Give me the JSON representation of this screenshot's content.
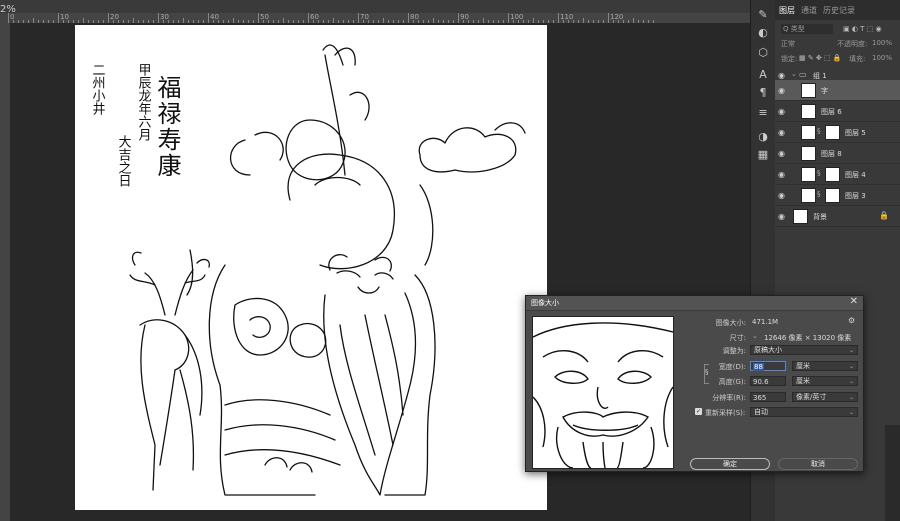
{
  "document": {
    "zoom_tab": "2%"
  },
  "rulers": {
    "top_numbers": [
      "0",
      "10",
      "20",
      "30",
      "40",
      "50",
      "60",
      "70",
      "80",
      "90",
      "100",
      "110",
      "120"
    ]
  },
  "artwork": {
    "title_chars": "福禄寿康",
    "inscription_line1": "甲辰龙年六月",
    "inscription_line2": "大吉之日",
    "signature": "二州小井"
  },
  "layers_panel": {
    "tabs": [
      "图层",
      "通道",
      "历史记录"
    ],
    "filter_label": "Q 类型",
    "blend_mode": "正常",
    "opacity_label": "不透明度:",
    "opacity_value": "100%",
    "lock_label": "锁定:",
    "fill_label": "填充:",
    "fill_value": "100%",
    "layers": [
      {
        "name": "组 1",
        "type": "group"
      },
      {
        "name": "字",
        "type": "layer",
        "selected": true
      },
      {
        "name": "图层 6",
        "type": "layer"
      },
      {
        "name": "图层 5",
        "type": "masked"
      },
      {
        "name": "图层 8",
        "type": "layer"
      },
      {
        "name": "图层 4",
        "type": "masked"
      },
      {
        "name": "图层 3",
        "type": "masked"
      },
      {
        "name": "背景",
        "type": "background"
      }
    ]
  },
  "dialog": {
    "title": "图像大小",
    "image_size_label": "图像大小:",
    "image_size_value": "471.1M",
    "dimensions_label": "尺寸:",
    "dimensions_value": "12646 像素 × 13020 像素",
    "fit_to_label": "调整为:",
    "fit_to_value": "原稿大小",
    "width_label": "宽度(D):",
    "width_value": "88",
    "width_unit": "厘米",
    "height_label": "高度(G):",
    "height_value": "90.6",
    "height_unit": "厘米",
    "resolution_label": "分辨率(R):",
    "resolution_value": "365",
    "resolution_unit": "像素/英寸",
    "resample_label": "重新采样(S):",
    "resample_value": "自动",
    "ok_label": "确定",
    "cancel_label": "取消"
  },
  "colors": {
    "panel_bg": "#393939",
    "selected_layer": "#595959",
    "canvas": "#ffffff",
    "focus": "#2f5ea7"
  }
}
